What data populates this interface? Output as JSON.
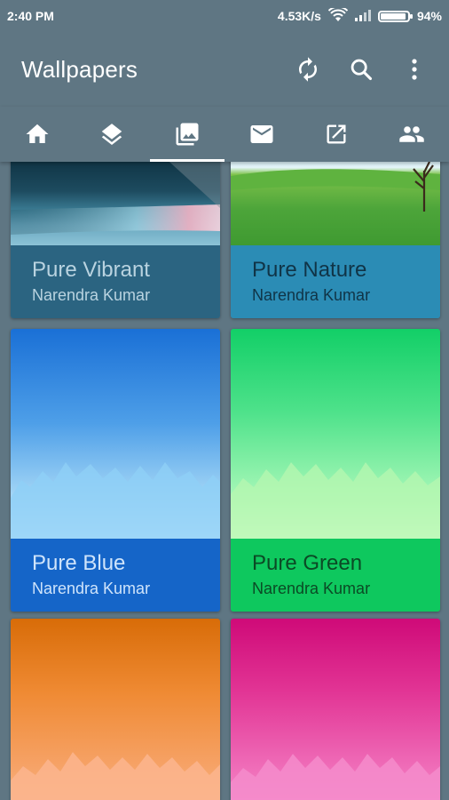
{
  "status": {
    "time": "2:40 PM",
    "speed": "4.53K/s",
    "battery": "94%",
    "battery_level": 0.94
  },
  "appbar": {
    "title": "Wallpapers"
  },
  "actions": [
    "refresh-icon",
    "search-icon",
    "more-vert-icon"
  ],
  "tabs": [
    {
      "icon": "home-icon"
    },
    {
      "icon": "layers-icon"
    },
    {
      "icon": "photo-library-icon",
      "active": true
    },
    {
      "icon": "mail-icon"
    },
    {
      "icon": "open-external-icon"
    },
    {
      "icon": "people-icon"
    }
  ],
  "cards": [
    {
      "name": "Pure Vibrant",
      "author": "Narendra Kumar",
      "caption_color": "#2b6481",
      "text_color": "#b9d3e0"
    },
    {
      "name": "Pure Nature",
      "author": "Narendra Kumar",
      "caption_color": "#2b8cb5",
      "text_color": "#103447"
    },
    {
      "name": "Pure Blue",
      "author": "Narendra Kumar",
      "caption_color": "#1565c8",
      "text_color": "#cfe4fb"
    },
    {
      "name": "Pure Green",
      "author": "Narendra Kumar",
      "caption_color": "#0ec85e",
      "text_color": "#0b4a25"
    },
    {
      "name": "",
      "author": ""
    },
    {
      "name": "",
      "author": ""
    }
  ]
}
